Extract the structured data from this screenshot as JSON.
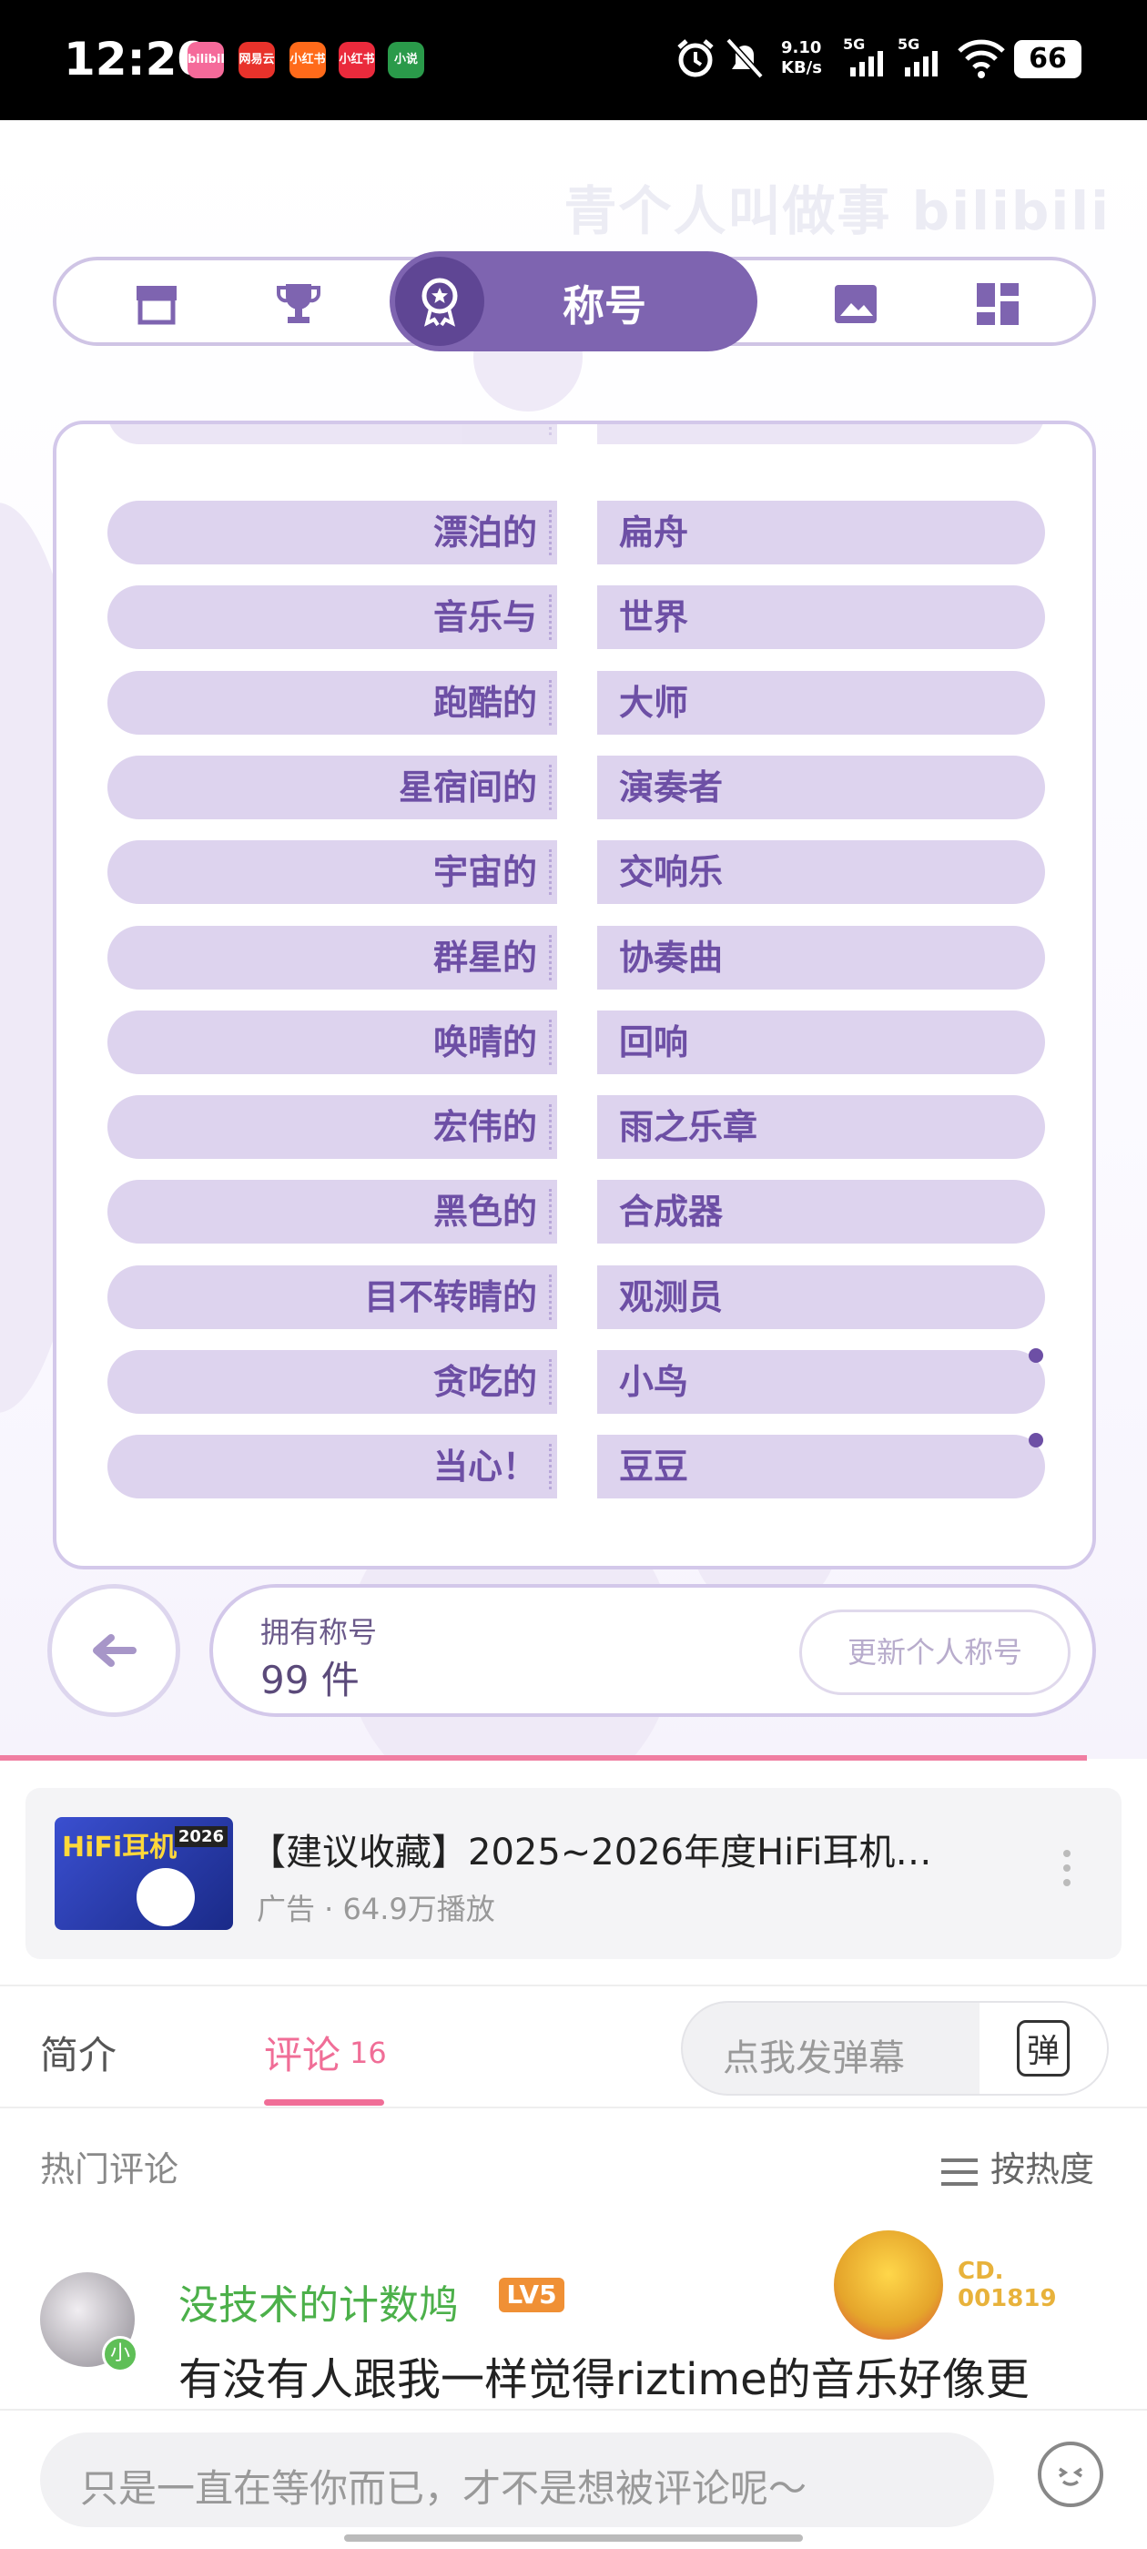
{
  "status_bar": {
    "time": "12:20",
    "app_icons": [
      "bilibili",
      "网易云",
      "小红书",
      "小红书",
      "小说"
    ],
    "network_speed": "9.10\nKB/s",
    "signal_1": "5G",
    "signal_2": "5G",
    "battery": "66"
  },
  "game": {
    "watermark": "青个人叫做事 bilibili",
    "tabs": [
      {
        "name": "shop",
        "icon": "shop-icon"
      },
      {
        "name": "trophy",
        "icon": "trophy-icon"
      },
      {
        "name": "titles",
        "icon": "medal-icon",
        "label": "称号",
        "active": true
      },
      {
        "name": "images",
        "icon": "image-icon"
      },
      {
        "name": "layout",
        "icon": "grid-icon"
      }
    ],
    "titles": [
      {
        "prefix": "漂泊的",
        "suffix": "扁舟",
        "new": false
      },
      {
        "prefix": "音乐与",
        "suffix": "世界",
        "new": false
      },
      {
        "prefix": "跑酷的",
        "suffix": "大师",
        "new": false
      },
      {
        "prefix": "星宿间的",
        "suffix": "演奏者",
        "new": false
      },
      {
        "prefix": "宇宙的",
        "suffix": "交响乐",
        "new": false
      },
      {
        "prefix": "群星的",
        "suffix": "协奏曲",
        "new": false
      },
      {
        "prefix": "唤晴的",
        "suffix": "回响",
        "new": false
      },
      {
        "prefix": "宏伟的",
        "suffix": "雨之乐章",
        "new": false
      },
      {
        "prefix": "黑色的",
        "suffix": "合成器",
        "new": false
      },
      {
        "prefix": "目不转睛的",
        "suffix": "观测员",
        "new": false
      },
      {
        "prefix": "贪吃的",
        "suffix": "小鸟",
        "new": true
      },
      {
        "prefix": "当心！",
        "suffix": "豆豆",
        "new": true
      }
    ],
    "owned_label": "拥有称号",
    "owned_count": "99 件",
    "update_button": "更新个人称号",
    "accent_color": "#7e64b0"
  },
  "ad": {
    "title": "【建议收藏】2025~2026年度HiFi耳机…",
    "meta": "广告 · 64.9万播放",
    "thumb_text": "HiFi耳机",
    "thumb_year": "2026"
  },
  "tabs": {
    "intro": "简介",
    "comments": "评论",
    "comments_count": "16",
    "danmaku_placeholder": "点我发弹幕",
    "danmaku_button": "弹"
  },
  "comments": {
    "section_label": "热门评论",
    "sort_label": "按热度",
    "items": [
      {
        "username": "没技术的计数鸠",
        "level": "LV5",
        "badge": "小",
        "decor_code": "CD.\n001819",
        "text": "有没有人跟我一样觉得riztime的音乐好像更"
      }
    ]
  },
  "reply": {
    "placeholder": "只是一直在等你而已，才不是想被评论呢～"
  }
}
